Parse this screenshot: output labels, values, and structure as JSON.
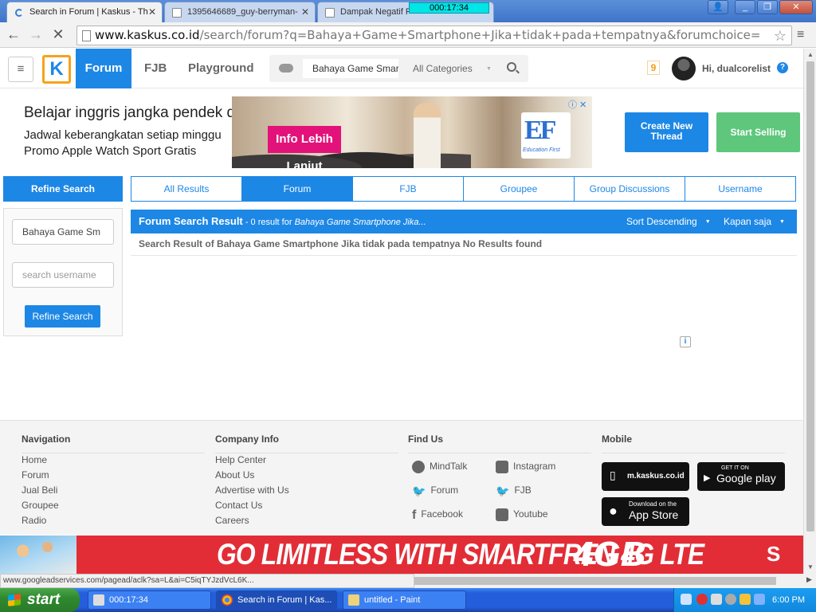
{
  "browser": {
    "tabs": [
      {
        "title": "Search in Forum | Kaskus - Th",
        "active": true
      },
      {
        "title": "1395646689_guy-berryman-",
        "active": false
      },
      {
        "title": "Dampak Negatif P",
        "active": false
      }
    ],
    "timer": "000:17:34",
    "url_host": "www.kaskus.co.id",
    "url_path": "/search/forum?q=Bahaya+Game+Smartphone+Jika+tidak+pada+tempatnya&forumchoice=",
    "status_url": "www.googleadservices.com/pagead/aclk?sa=L&ai=C5iqTYJzdVcL6K..."
  },
  "header": {
    "logo": "K",
    "nav": {
      "forum": "Forum",
      "fjb": "FJB",
      "playground": "Playground"
    },
    "search_value": "Bahaya Game Smar",
    "category": "All Categories",
    "notif_count": "9",
    "greeting": "Hi, dualcorelist",
    "help": "?"
  },
  "ad": {
    "line1": "Belajar inggris jangka pendek di Luar Negeri",
    "line2": "Jadwal keberangkatan setiap minggu",
    "line3": "Promo Apple Watch Sport Gratis",
    "cta": "Info Lebih Lanjut",
    "brand_mark": "EF",
    "brand_caption": "Education First"
  },
  "actions": {
    "create_line1": "Create New",
    "create_line2": "Thread",
    "sell": "Start Selling"
  },
  "refine": {
    "heading": "Refine Search",
    "query_value": "Bahaya Game Sm",
    "username_placeholder": "search username",
    "button": "Refine Search"
  },
  "tabs": [
    "All Results",
    "Forum",
    "FJB",
    "Groupee",
    "Group Discussions",
    "Username"
  ],
  "result": {
    "title": "Forum Search Result",
    "count_text": " - 0 result for ",
    "query": "Bahaya Game Smartphone Jika...",
    "sort": "Sort Descending",
    "when": "Kapan saja",
    "message": "Search Result of Bahaya Game Smartphone Jika tidak pada tempatnya No Results found"
  },
  "footer": {
    "navigation": {
      "heading": "Navigation",
      "links": [
        "Home",
        "Forum",
        "Jual Beli",
        "Groupee",
        "Radio"
      ]
    },
    "company": {
      "heading": "Company Info",
      "links": [
        "Help Center",
        "About Us",
        "Advertise with Us",
        "Contact Us",
        "Careers"
      ]
    },
    "find_us": {
      "heading": "Find Us",
      "items": [
        "MindTalk",
        "Instagram",
        "Forum",
        "FJB",
        "Facebook",
        "Youtube"
      ]
    },
    "mobile": {
      "heading": "Mobile",
      "mkaskus": "m.kaskus.co.id",
      "gplay_top": "GET IT ON",
      "gplay": "Google play",
      "appstore_top": "Download on the",
      "appstore": "App Store"
    }
  },
  "bottom_ad": {
    "text": "GO LIMITLESS WITH SMARTFREN 4G LTE",
    "big": "4GB",
    "logo": "S"
  },
  "taskbar": {
    "start": "start",
    "tasks": [
      "000:17:34",
      "Search in Forum | Kas...",
      "untitled - Paint"
    ],
    "clock": "6:00 PM"
  },
  "colors": {
    "kaskus_blue": "#1d87e5",
    "sell_green": "#5ec77c",
    "smartfren_red": "#e22d37"
  }
}
